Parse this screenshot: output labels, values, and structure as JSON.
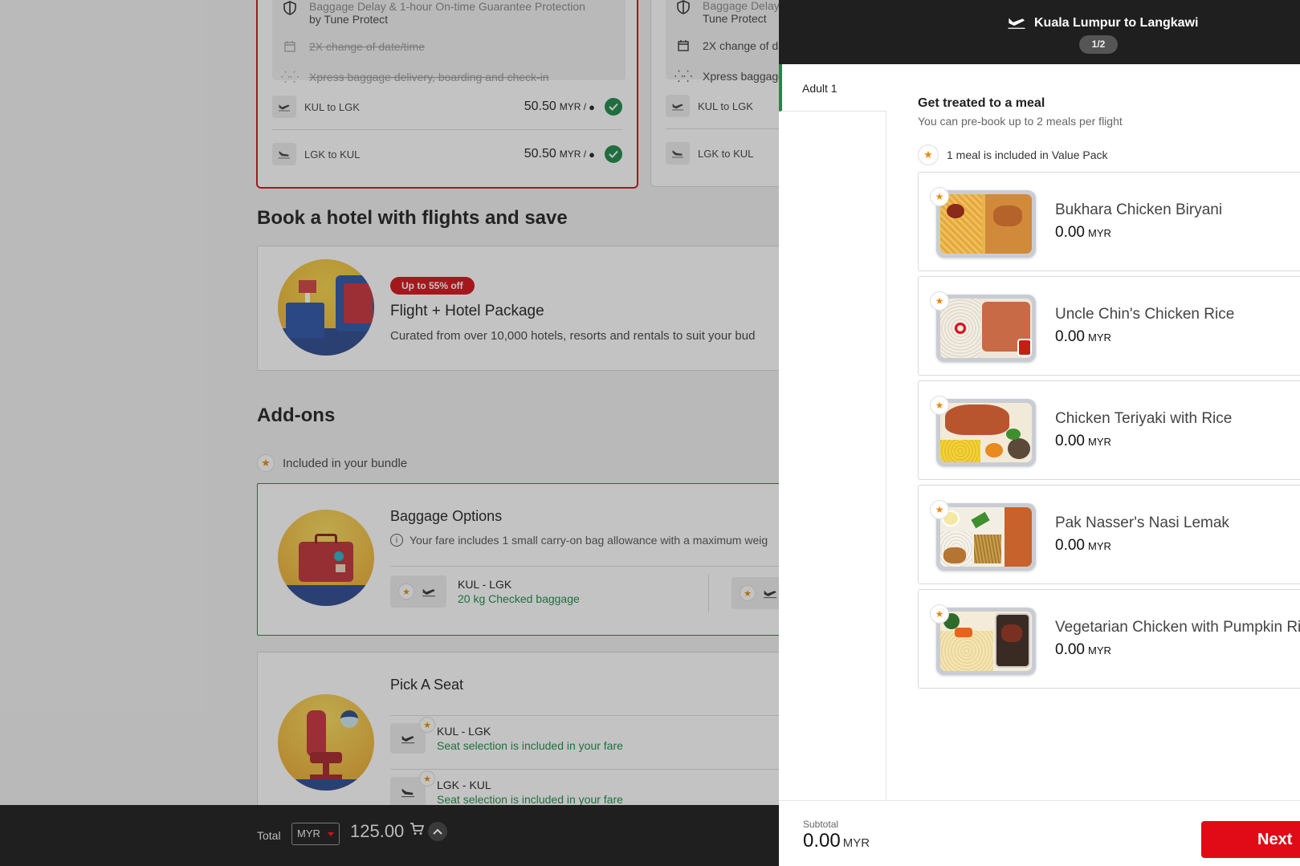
{
  "fare_cards": [
    {
      "insurance_text_line1": "Baggage Delay & 1-hour On-time Guarantee Protection",
      "insurance_text_line2": "by Tune Protect",
      "change_text": "2X change of date/time",
      "xpress_text": "Xpress baggage delivery, boarding and check-in",
      "routes": [
        {
          "label": "KUL to LGK",
          "price": "50.50",
          "unit": "MYR /"
        },
        {
          "label": "LGK to KUL",
          "price": "50.50",
          "unit": "MYR /"
        }
      ]
    },
    {
      "insurance_text_line1": "Baggage Delay",
      "insurance_text_line2": "Tune Protect",
      "change_text": "2X change of da",
      "xpress_text": "Xpress baggage",
      "routes": [
        {
          "label": "KUL to LGK"
        },
        {
          "label": "LGK to KUL"
        }
      ]
    }
  ],
  "hotel_section": {
    "title": "Book a hotel with flights and save",
    "badge": "Up to 55% off",
    "package_title": "Flight + Hotel Package",
    "package_desc": "Curated from over 10,000 hotels, resorts and rentals to suit your bud"
  },
  "addons": {
    "title": "Add-ons",
    "bundle_note": "Included in your bundle",
    "baggage": {
      "title": "Baggage Options",
      "info": "Your fare includes 1 small carry-on bag allowance with a maximum weig",
      "route": "KUL - LGK",
      "allowance": "20 kg Checked baggage"
    },
    "seat": {
      "title": "Pick A Seat",
      "rows": [
        {
          "route": "KUL - LGK",
          "status": "Seat selection is included in your fare"
        },
        {
          "route": "LGK - KUL",
          "status": "Seat selection is included in your fare"
        }
      ]
    }
  },
  "bottom_bar": {
    "total_label": "Total",
    "currency": "MYR",
    "total": "125.00"
  },
  "drawer": {
    "title": "Kuala Lumpur to Langkawi",
    "counter": "1/2",
    "passenger_tab": "Adult 1",
    "heading": "Get treated to a meal",
    "subheading": "You can pre-book up to 2 meals per flight",
    "included_note": "1 meal is included in Value Pack",
    "meals": [
      {
        "name": "Bukhara Chicken Biryani",
        "price": "0.00",
        "currency": "MYR"
      },
      {
        "name": "Uncle Chin's Chicken Rice",
        "price": "0.00",
        "currency": "MYR"
      },
      {
        "name": "Chicken Teriyaki with Rice",
        "price": "0.00",
        "currency": "MYR"
      },
      {
        "name": "Pak Nasser's Nasi Lemak",
        "price": "0.00",
        "currency": "MYR"
      },
      {
        "name": "Vegetarian Chicken with Pumpkin Ri",
        "price": "0.00",
        "currency": "MYR"
      }
    ],
    "subtotal_label": "Subtotal",
    "subtotal_value": "0.00",
    "subtotal_currency": "MYR",
    "next_label": "Next"
  },
  "colors": {
    "brand_red": "#e00b16",
    "success_green": "#1e8a4a",
    "star_orange": "#e88b0d",
    "header_dark": "#1f1f1f"
  }
}
